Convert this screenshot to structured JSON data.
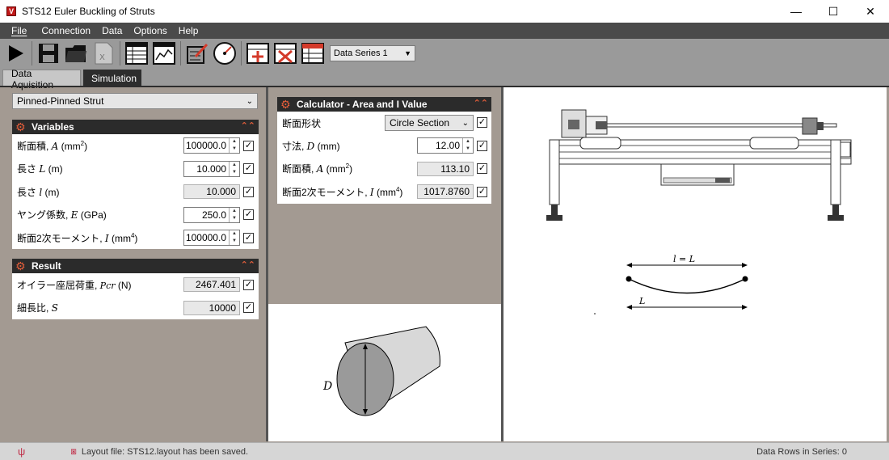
{
  "window": {
    "title": "STS12 Euler Buckling of Struts",
    "logo_letter": "V",
    "minimize": "—",
    "maximize": "☐",
    "close": "✕"
  },
  "menu": [
    "File",
    "Connection",
    "Data",
    "Options",
    "Help"
  ],
  "toolbar": {
    "series_select": "Data Series 1",
    "icons": [
      "play-icon",
      "save-icon",
      "open-folder-icon",
      "export-excel-icon",
      "table-view-icon",
      "chart-view-icon",
      "edit-checklist-icon",
      "gauge-icon",
      "add-row-icon",
      "delete-row-icon",
      "table-settings-icon"
    ]
  },
  "tabs": [
    {
      "label": "Data Aquisition",
      "active": false
    },
    {
      "label": "Simulation",
      "active": true
    }
  ],
  "strut_type": "Pinned-Pinned Strut",
  "variables": {
    "header": "Variables",
    "rows": [
      {
        "label": "断面積, ",
        "sym": "A",
        "unit": " (mm",
        "sup": "2",
        "unit_end": ")",
        "value": "100000.0",
        "editable": true
      },
      {
        "label": "長さ ",
        "sym": "L",
        "unit": " (m)",
        "sup": "",
        "unit_end": "",
        "value": "10.000",
        "editable": true
      },
      {
        "label": "長さ ",
        "sym": "l",
        "unit": " (m)",
        "sup": "",
        "unit_end": "",
        "value": "10.000",
        "editable": false
      },
      {
        "label": "ヤング係数, ",
        "sym": "E",
        "unit": " (GPa)",
        "sup": "",
        "unit_end": "",
        "value": "250.0",
        "editable": true
      },
      {
        "label": "断面2次モーメント, ",
        "sym": "I",
        "unit": " (mm",
        "sup": "4",
        "unit_end": ")",
        "value": "100000.0",
        "editable": true
      }
    ]
  },
  "result": {
    "header": "Result",
    "rows": [
      {
        "label": "オイラー座屈荷重, ",
        "sym": "Pcr",
        "unit": " (N)",
        "value": "2467.401"
      },
      {
        "label": "細長比, ",
        "sym": "S",
        "unit": "",
        "value": "10000"
      }
    ]
  },
  "calculator": {
    "header": "Calculator - Area and I Value",
    "shape_label": "断面形状",
    "shape_value": "Circle Section",
    "rows": [
      {
        "label": "寸法, ",
        "sym": "D",
        "unit": " (mm)",
        "sup": "",
        "unit_end": "",
        "value": "12.00",
        "editable": true
      },
      {
        "label": "断面積, ",
        "sym": "A",
        "unit": " (mm",
        "sup": "2",
        "unit_end": ")",
        "value": "113.10",
        "editable": false
      },
      {
        "label": "断面2次モーメント, ",
        "sym": "I",
        "unit": " (mm",
        "sup": "4",
        "unit_end": ")",
        "value": "1017.8760",
        "editable": false
      }
    ]
  },
  "diagrams": {
    "section_label": "D",
    "top_label": "l = L",
    "bottom_label": "L"
  },
  "status": {
    "layout_msg": "Layout file: STS12.layout has been saved.",
    "rows_msg": "Data Rows in Series: 0"
  },
  "colors": {
    "header_bg": "#2b2b2b",
    "accent": "#e45e3a",
    "app_bg": "#a39a92"
  }
}
